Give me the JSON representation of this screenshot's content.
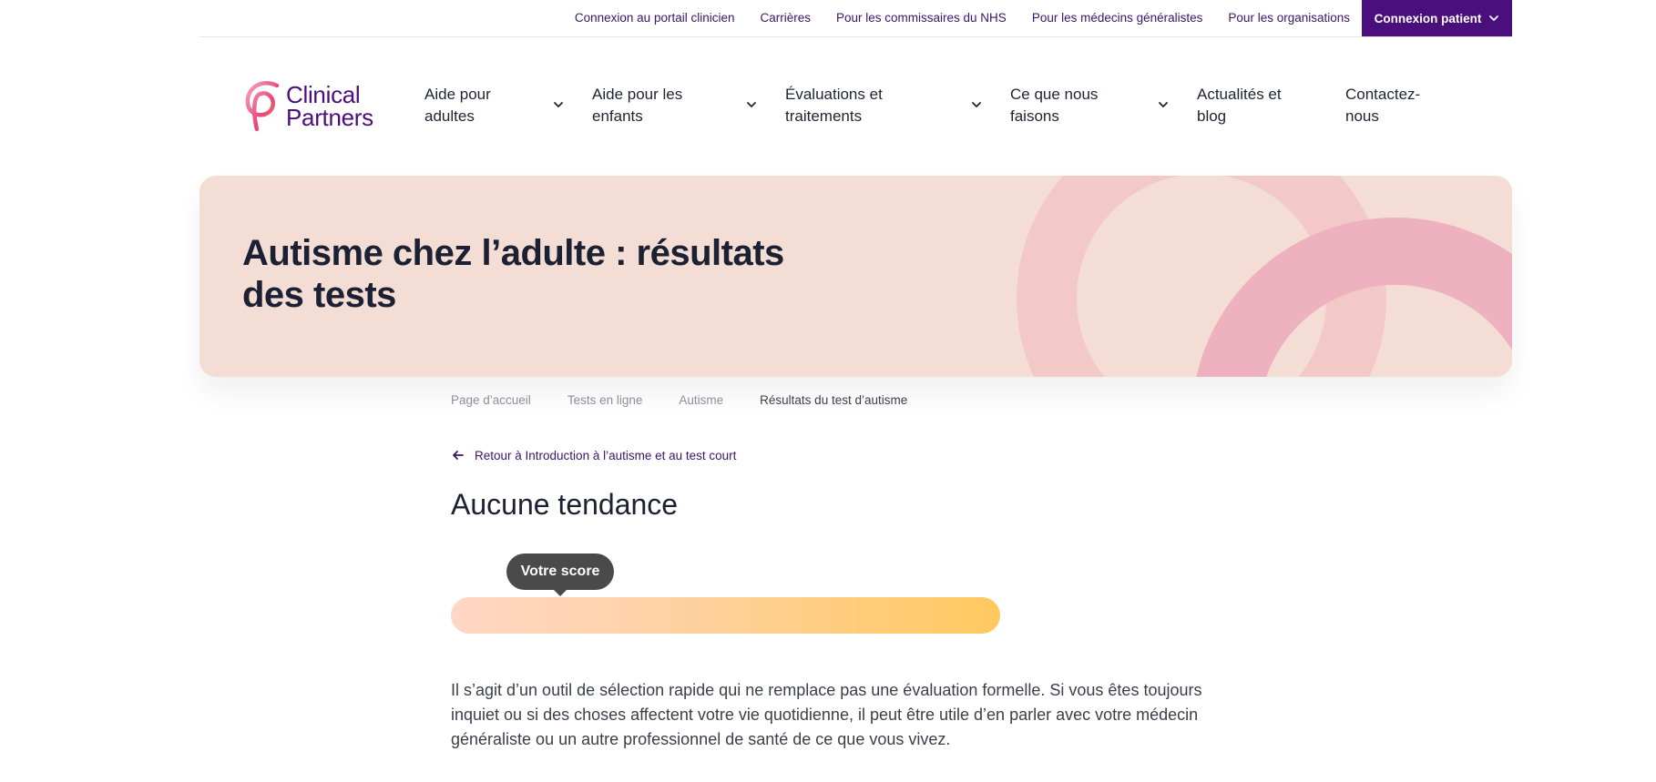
{
  "topbar": {
    "links": [
      "Connexion au portail clinicien",
      "Carrières",
      "Pour les commissaires du NHS",
      "Pour les médecins généralistes",
      "Pour les organisations"
    ],
    "patient_button": "Connexion patient"
  },
  "logo": {
    "line1": "Clinical",
    "line2": "Partners"
  },
  "nav": [
    {
      "line1": "Aide pour",
      "line2": "adultes"
    },
    {
      "line1": "Aide pour les",
      "line2": "enfants"
    },
    {
      "line1": "Évaluations et",
      "line2": "traitements"
    },
    {
      "line1": "Ce que nous",
      "line2": "faisons"
    },
    {
      "line1": "Actualités et",
      "line2": "blog"
    },
    {
      "line1": "Contactez-",
      "line2": "nous"
    }
  ],
  "hero": {
    "title_line1": "Autisme chez l’adulte : résultats",
    "title_line2": "des tests"
  },
  "breadcrumb": [
    "Page d’accueil",
    "Tests en ligne",
    "Autisme",
    "Résultats du test d’autisme"
  ],
  "back_link": "Retour à Introduction à l’autisme et au test court",
  "result": {
    "title": "Aucune tendance",
    "tooltip": "Votre score",
    "score_fraction": 0.2
  },
  "description": "Il s’agit d’un outil de sélection rapide qui ne remplace pas une évaluation formelle. Si vous êtes toujours inquiet ou si des choses affectent votre vie quotidienne, il peut être utile d’en parler avec votre médecin généraliste ou un autre professionnel de santé de ce que vous vivez.",
  "colors": {
    "brand_purple": "#4a0e7d",
    "hero_bg": "#f3ddd4",
    "hero_arc_light": "#f2c9c6",
    "hero_arc_dark": "#eeb1bf",
    "bar_start": "#ffd7c4",
    "bar_end": "#ffc95f"
  },
  "icons": {
    "patient_button": "chevron-down-icon",
    "nav": "chevron-down-icon",
    "back": "arrow-left-icon",
    "logo": "clinical-partners-logo-icon"
  }
}
